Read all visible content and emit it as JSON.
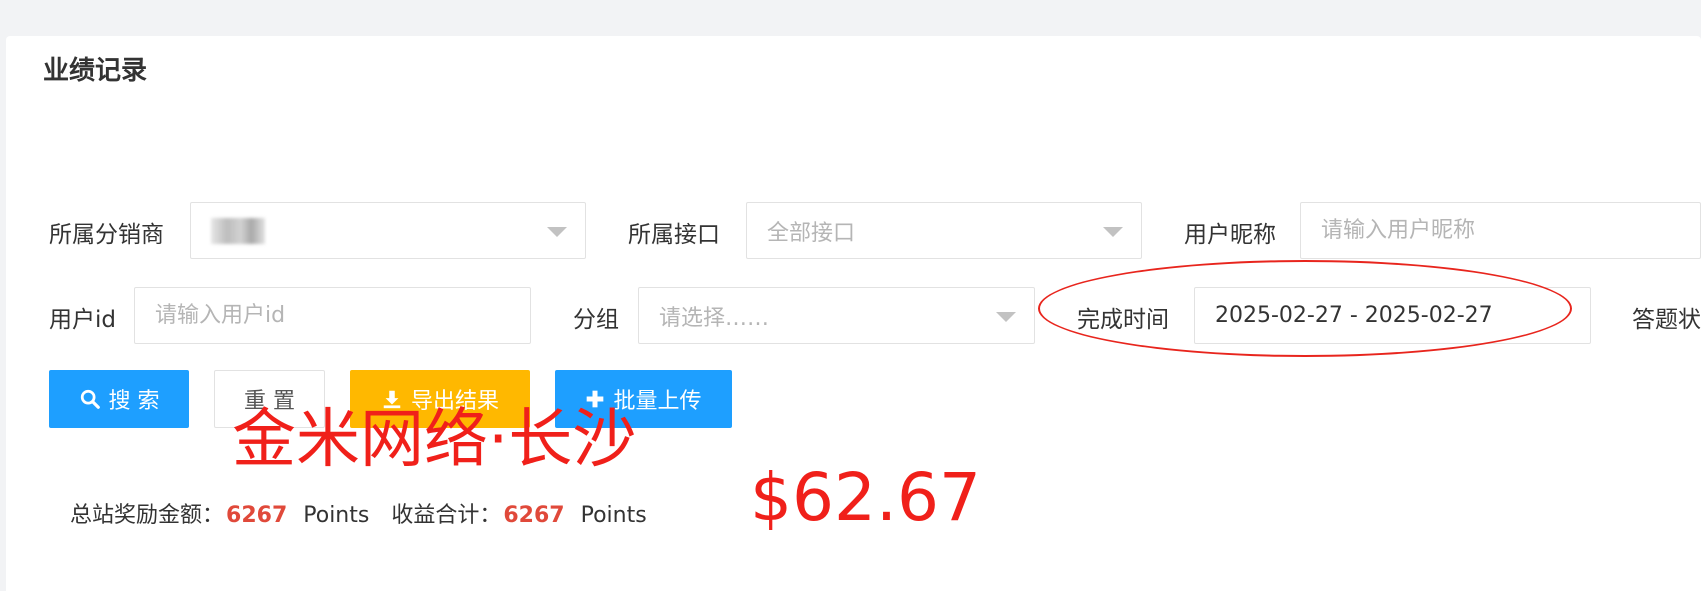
{
  "page": {
    "title": "业绩记录"
  },
  "filters": {
    "distributor": {
      "label": "所属分销商"
    },
    "interface": {
      "label": "所属接口",
      "value": "全部接口"
    },
    "nickname": {
      "label": "用户昵称",
      "placeholder": "请输入用户昵称"
    },
    "user_id": {
      "label": "用户id",
      "placeholder": "请输入用户id"
    },
    "group": {
      "label": "分组",
      "placeholder": "请选择……"
    },
    "completion_time": {
      "label": "完成时间",
      "value": "2025-02-27 - 2025-02-27"
    },
    "answer_status": {
      "label": "答题状"
    }
  },
  "buttons": {
    "search": "搜 索",
    "reset": "重 置",
    "export": "导出结果",
    "batch_upload": "批量上传"
  },
  "summary": {
    "total_reward_label": "总站奖励金额：",
    "total_reward_value": "6267",
    "total_reward_unit": "Points",
    "income_total_label": "收益合计：",
    "income_total_value": "6267",
    "income_total_unit": "Points"
  },
  "annotations": {
    "watermark": "金米网络·长沙",
    "amount": "$62.67"
  },
  "colors": {
    "primary": "#1e9fff",
    "warning": "#ffb800",
    "highlight_number": "#e0493a",
    "annotation_red": "#f0201a"
  }
}
